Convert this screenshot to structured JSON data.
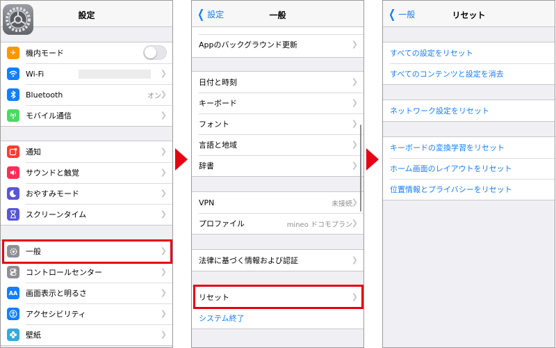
{
  "panels": [
    {
      "title": "設定",
      "groups": [
        [
          {
            "label": "機内モード",
            "icon": "airplane-icon",
            "color": "#ff9500",
            "glyph": "✈",
            "toggle": "off"
          },
          {
            "label": "Wi-Fi",
            "icon": "wifi-icon",
            "color": "#147efb",
            "glyph": "≋",
            "value": ""
          },
          {
            "label": "Bluetooth",
            "icon": "bluetooth-icon",
            "color": "#147efb",
            "glyph": "ᛒ",
            "value": "オン"
          },
          {
            "label": "モバイル通信",
            "icon": "cellular-icon",
            "color": "#4cd964",
            "glyph": "((•))"
          }
        ],
        [
          {
            "label": "通知",
            "icon": "notifications-icon",
            "color": "#ff3b30",
            "glyph": "▣"
          },
          {
            "label": "サウンドと触覚",
            "icon": "sound-icon",
            "color": "#ff2d55",
            "glyph": "♪"
          },
          {
            "label": "おやすみモード",
            "icon": "moon-icon",
            "color": "#5856d6",
            "glyph": "☾"
          },
          {
            "label": "スクリーンタイム",
            "icon": "hourglass-icon",
            "color": "#5856d6",
            "glyph": "⧗"
          }
        ],
        [
          {
            "label": "一般",
            "icon": "gear-icon",
            "color": "#8e8e93",
            "glyph": "⚙"
          },
          {
            "label": "コントロールセンター",
            "icon": "control-center-icon",
            "color": "#8e8e93",
            "glyph": "⊜"
          },
          {
            "label": "画面表示と明るさ",
            "icon": "display-icon",
            "color": "#147efb",
            "glyph": "AA"
          },
          {
            "label": "アクセシビリティ",
            "icon": "accessibility-icon",
            "color": "#147efb",
            "glyph": "✪"
          },
          {
            "label": "壁紙",
            "icon": "wallpaper-icon",
            "color": "#34aadc",
            "glyph": "✿"
          }
        ]
      ]
    },
    {
      "back": "設定",
      "title": "一般",
      "groups": [
        [
          {
            "label": "Appのバックグラウンド更新"
          }
        ],
        [
          {
            "label": "日付と時刻"
          },
          {
            "label": "キーボード"
          },
          {
            "label": "フォント"
          },
          {
            "label": "言語と地域"
          },
          {
            "label": "辞書"
          }
        ],
        [
          {
            "label": "VPN",
            "value": "未接続"
          },
          {
            "label": "プロファイル",
            "value": "mineo ドコモプラン"
          }
        ],
        [
          {
            "label": "法律に基づく情報および認証"
          }
        ],
        [
          {
            "label": "リセット"
          },
          {
            "label": "システム終了",
            "blue": true,
            "nochevron": true
          }
        ]
      ]
    },
    {
      "back": "一般",
      "title": "リセット",
      "groups": [
        [
          {
            "label": "すべての設定をリセット"
          },
          {
            "label": "すべてのコンテンツと設定を消去"
          }
        ],
        [
          {
            "label": "ネットワーク設定をリセット"
          }
        ],
        [
          {
            "label": "キーボードの変換学習をリセット"
          },
          {
            "label": "ホーム画面のレイアウトをリセット"
          },
          {
            "label": "位置情報とプライバシーをリセット"
          }
        ]
      ]
    }
  ],
  "settings_app_icon": "settings-app-icon",
  "highlight_color": "#e60012"
}
